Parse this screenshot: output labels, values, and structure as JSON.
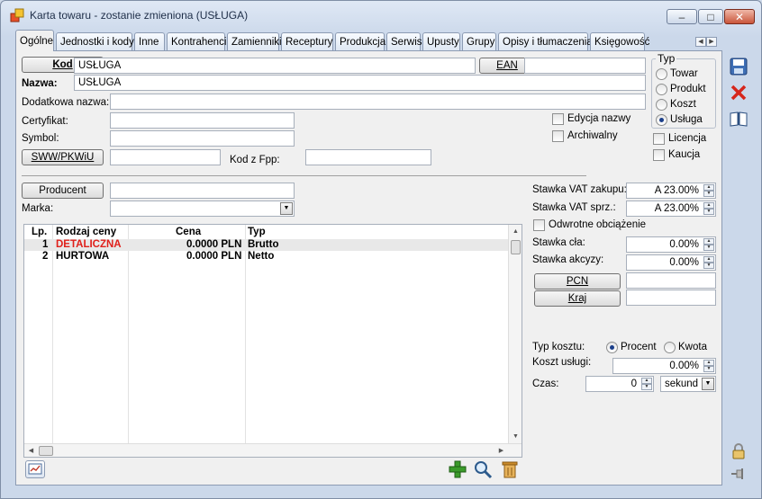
{
  "window": {
    "title": "Karta towaru - zostanie zmieniona (USŁUGA)",
    "minimize": "–",
    "maximize": "□",
    "close": "✕"
  },
  "tabs": [
    {
      "label": "Ogólne",
      "active": true
    },
    {
      "label": "Jednostki i kody"
    },
    {
      "label": "Inne"
    },
    {
      "label": "Kontrahenci"
    },
    {
      "label": "Zamienniki"
    },
    {
      "label": "Receptury"
    },
    {
      "label": "Produkcja"
    },
    {
      "label": "Serwis"
    },
    {
      "label": "Upusty"
    },
    {
      "label": "Grupy"
    },
    {
      "label": "Opisy i tłumaczenia"
    },
    {
      "label": "Księgowość"
    }
  ],
  "form": {
    "kod_button": "Kod",
    "kod_value": "USŁUGA",
    "ean_button": "EAN",
    "ean_value": "",
    "nazwa_label": "Nazwa:",
    "nazwa_value": "USŁUGA",
    "dodatkowa_label": "Dodatkowa nazwa:",
    "dodatkowa_value": "",
    "certyfikat_label": "Certyfikat:",
    "certyfikat_value": "",
    "symbol_label": "Symbol:",
    "symbol_value": "",
    "sww_button": "SWW/PKWiU",
    "sww_value": "",
    "kodfpp_label": "Kod z Fpp:",
    "kodfpp_value": "",
    "edycja_nazwy": "Edycja nazwy",
    "archiwalny": "Archiwalny",
    "producent_button": "Producent",
    "producent_value": "",
    "marka_label": "Marka:",
    "marka_value": ""
  },
  "typ_group": {
    "title": "Typ",
    "options": [
      "Towar",
      "Produkt",
      "Koszt",
      "Usługa"
    ],
    "selected": "Usługa"
  },
  "flags": {
    "licencja": "Licencja",
    "kaucja": "Kaucja"
  },
  "grid": {
    "headers": [
      "Lp.",
      "Rodzaj ceny",
      "Cena",
      "Typ"
    ],
    "rows": [
      {
        "lp": "1",
        "rodzaj": "DETALICZNA",
        "cena": "0.0000 PLN",
        "typ": "Brutto",
        "color": "#e0201b"
      },
      {
        "lp": "2",
        "rodzaj": "HURTOWA",
        "cena": "0.0000 PLN",
        "typ": "Netto",
        "color": "#000000"
      }
    ]
  },
  "vat": {
    "zakupu_label": "Stawka VAT zakupu:",
    "zakupu_value": "A 23.00%",
    "sprz_label": "Stawka VAT sprz.:",
    "sprz_value": "A 23.00%",
    "odwrotne": "Odwrotne obciążenie",
    "cla_label": "Stawka cła:",
    "cla_value": "0.00%",
    "akcyzy_label": "Stawka akcyzy:",
    "akcyzy_value": "0.00%",
    "pcn_button": "PCN",
    "pcn_value": "",
    "kraj_button": "Kraj",
    "kraj_value": ""
  },
  "koszt": {
    "typ_label": "Typ kosztu:",
    "procent": "Procent",
    "kwota": "Kwota",
    "selected": "Procent",
    "koszt_label": "Koszt usługi:",
    "koszt_value": "0.00%",
    "czas_label": "Czas:",
    "czas_value": "0",
    "czas_unit": "sekund"
  },
  "icons": {
    "app": "app-icon",
    "save": "save-icon",
    "cancel": "cancel-icon",
    "book": "book-icon",
    "lock": "lock-icon",
    "pin": "pin-icon",
    "chart": "chart-icon",
    "add": "add-icon",
    "search": "search-icon",
    "delete": "delete-icon"
  },
  "colors": {
    "accent": "#1b3f8a",
    "red_row": "#e0201b",
    "add_green": "#3b9b2b",
    "delete_orange": "#c98a2a"
  }
}
